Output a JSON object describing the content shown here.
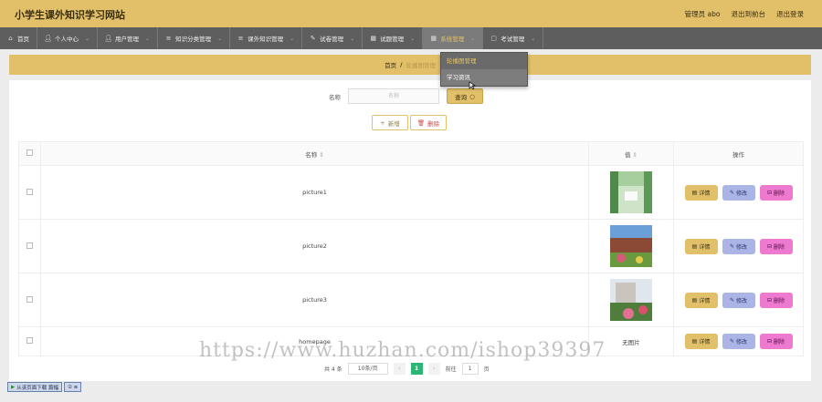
{
  "header": {
    "site_title": "小学生课外知识学习网站",
    "admin_label": "管理员 abo",
    "back_frontend": "退出到前台",
    "logout": "退出登录"
  },
  "nav": {
    "items": [
      {
        "label": "首页",
        "icon": "home-icon"
      },
      {
        "label": "个人中心",
        "icon": "user-icon"
      },
      {
        "label": "用户管理",
        "icon": "user-icon"
      },
      {
        "label": "知识分类管理",
        "icon": "list-icon"
      },
      {
        "label": "课外知识管理",
        "icon": "list-icon"
      },
      {
        "label": "试卷管理",
        "icon": "paper-icon"
      },
      {
        "label": "试题管理",
        "icon": "grid-icon"
      },
      {
        "label": "系统管理",
        "icon": "grid-icon"
      },
      {
        "label": "考试管理",
        "icon": "exam-icon"
      }
    ],
    "dropdown": [
      "轮播图管理",
      "学习资讯"
    ]
  },
  "breadcrumb": {
    "home": "首页",
    "separator": "/",
    "current": "轮播图管理"
  },
  "search": {
    "label": "名称",
    "placeholder": "名称",
    "query_label": "查询"
  },
  "toolbar": {
    "add_label": "新增",
    "delete_label": "删除"
  },
  "table": {
    "headers": {
      "name": "名称",
      "value": "值",
      "actions": "操作"
    },
    "rows": [
      {
        "name": "picture1",
        "value": ""
      },
      {
        "name": "picture2",
        "value": ""
      },
      {
        "name": "picture3",
        "value": ""
      },
      {
        "name": "homepage",
        "value": "无图片"
      }
    ],
    "action_labels": {
      "detail": "详情",
      "edit": "修改",
      "delete": "删除"
    }
  },
  "pagination": {
    "total": "共 4 条",
    "page_size": "10条/页",
    "current_page": "1",
    "goto_label": "前往",
    "goto_value": "1",
    "page_unit": "页"
  },
  "watermark": "https://www.huzhan.com/ishop39397",
  "bottom_bar": {
    "download_label": "从该页面下载 篇幅",
    "extra_label": "② ≡"
  },
  "colors": {
    "accent": "#e2c069",
    "nav_bg": "#5e5e5e",
    "edit": "#aab5e6",
    "delete": "#ee7ad0",
    "page_active": "#2bb673"
  }
}
